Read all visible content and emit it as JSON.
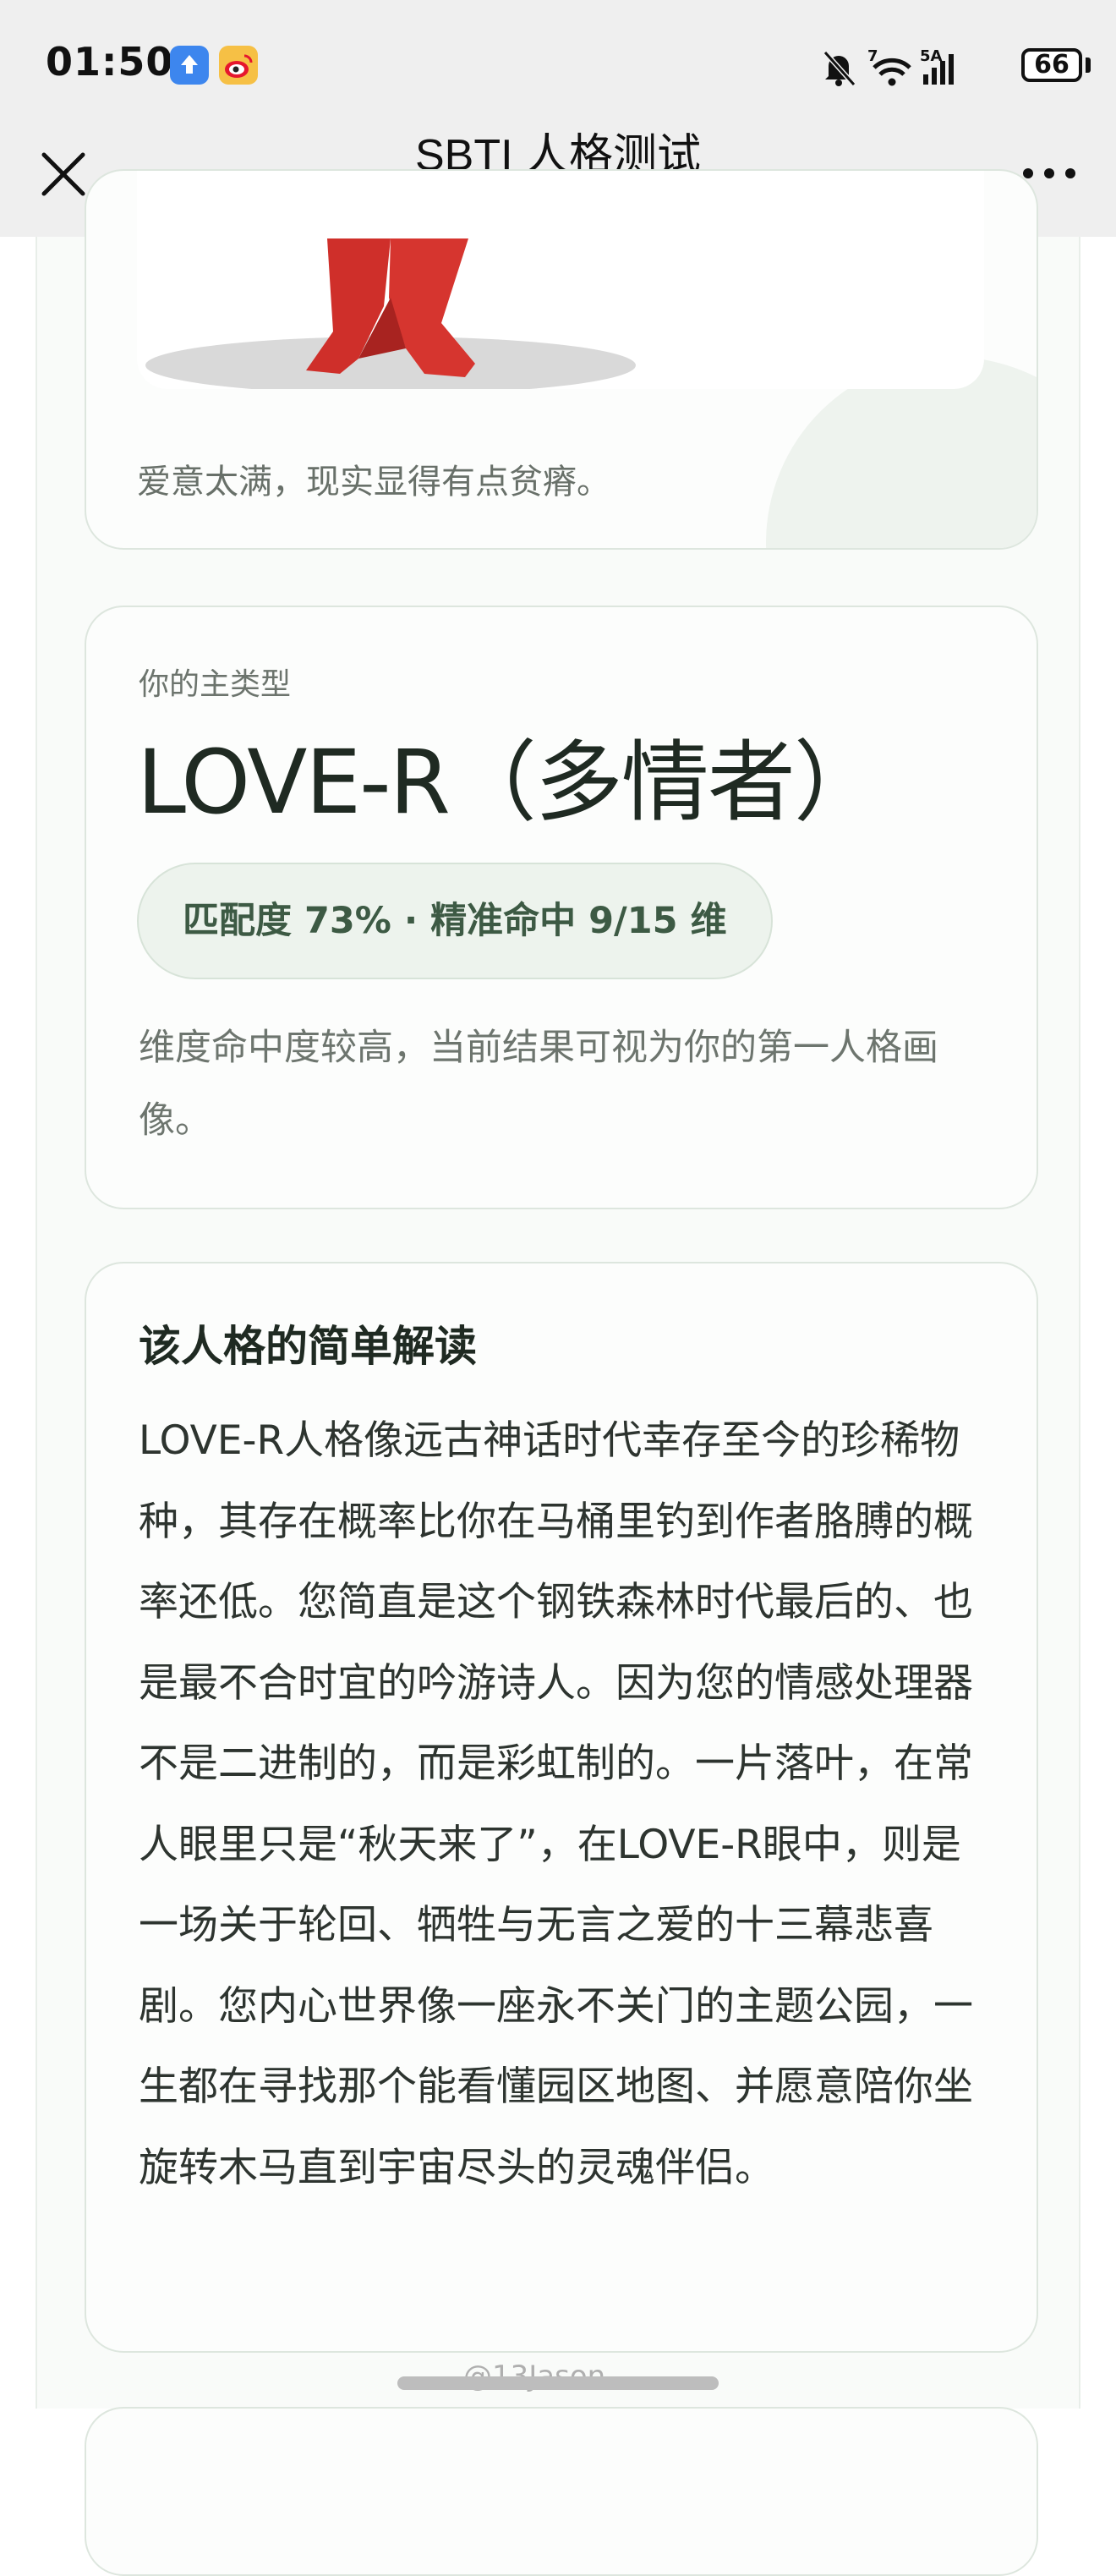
{
  "status_bar": {
    "time": "01:50",
    "battery": "66",
    "network": "5A",
    "wifi_label": "7",
    "icons": [
      "upload-app-icon",
      "weibo-app-icon",
      "mute-bell-icon",
      "wifi-icon",
      "signal-icon",
      "battery-icon"
    ]
  },
  "nav": {
    "title": "SBTI 人格测试",
    "close_icon": "close-icon",
    "more_icon": "more-icon"
  },
  "colors": {
    "accent": "#3d5a44",
    "figure_red": "#d6352f",
    "card_border": "#dde6de"
  },
  "card_image": {
    "caption": "爱意太满，现实显得有点贫瘠。"
  },
  "main_type": {
    "label": "你的主类型",
    "value": "LOVE-R（多情者）",
    "match_badge": "匹配度 73% · 精准命中 9/15 维",
    "description": "维度命中度较高，当前结果可视为你的第一人格画像。"
  },
  "interpretation": {
    "title": "该人格的简单解读",
    "body": "LOVE-R人格像远古神话时代幸存至今的珍稀物种，其存在概率比你在马桶里钓到作者胳膊的概率还低。您简直是这个钢铁森林时代最后的、也是最不合时宜的吟游诗人。因为您的情感处理器不是二进制的，而是彩虹制的。一片落叶，在常人眼里只是“秋天来了”，在LOVE-R眼中，则是一场关于轮回、牺牲与无言之爱的十三幕悲喜剧。您内心世界像一座永不关门的主题公园，一生都在寻找那个能看懂园区地图、并愿意陪你坐旋转木马直到宇宙尽头的灵魂伴侣。"
  },
  "watermark": "@13Jason"
}
